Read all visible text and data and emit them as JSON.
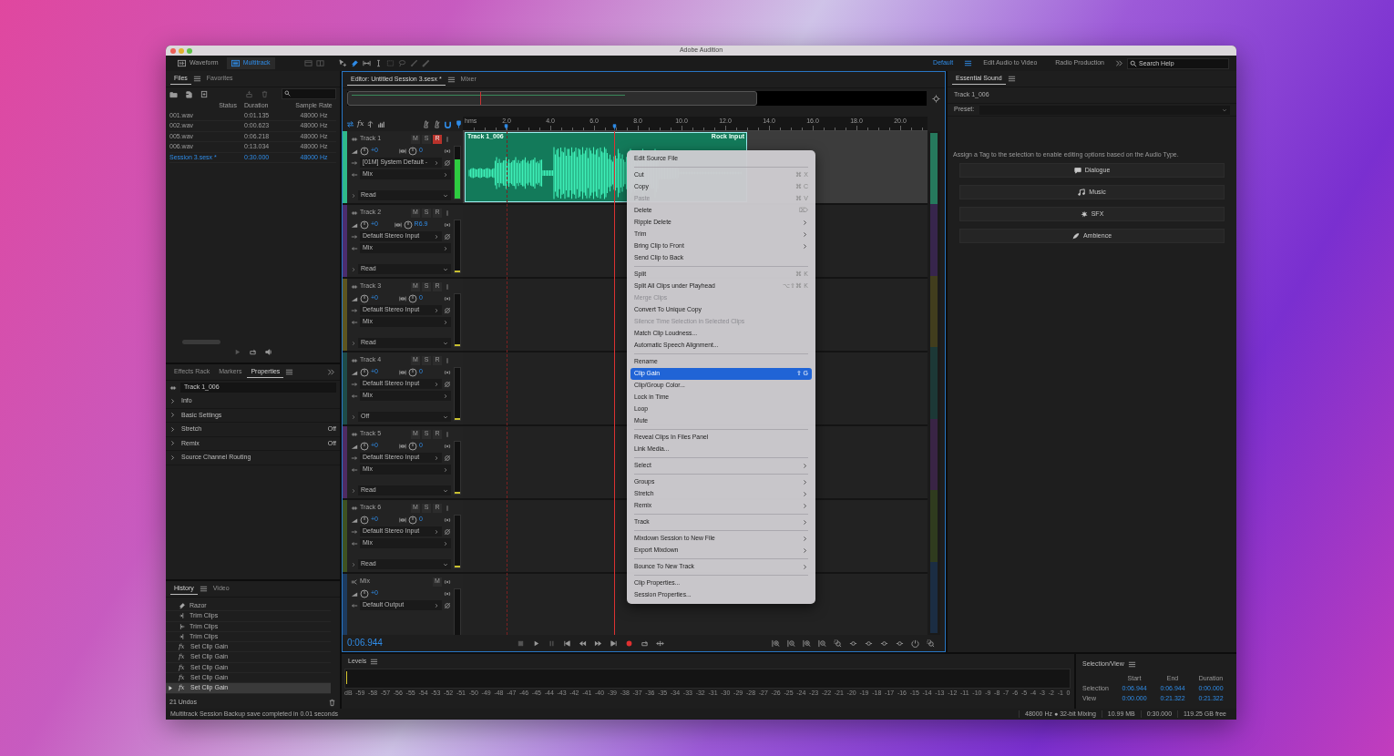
{
  "window": {
    "title": "Adobe Audition"
  },
  "toolbar": {
    "modes": [
      {
        "label": "Waveform",
        "selected": false
      },
      {
        "label": "Multitrack",
        "selected": true
      }
    ],
    "workspaces": [
      {
        "label": "Default",
        "selected": true
      },
      {
        "label": "Edit Audio to Video",
        "selected": false
      },
      {
        "label": "Radio Production",
        "selected": false
      }
    ],
    "search": {
      "placeholder": "Search Help"
    }
  },
  "files_panel": {
    "tabs": [
      {
        "label": "Files",
        "selected": true
      },
      {
        "label": "Favorites",
        "selected": false
      }
    ],
    "columns": [
      "Status",
      "Duration",
      "Sample Rate"
    ],
    "rows": [
      {
        "name": "001.wav",
        "duration": "0:01.135",
        "rate": "48000 Hz",
        "selected": false
      },
      {
        "name": "002.wav",
        "duration": "0:00.623",
        "rate": "48000 Hz",
        "selected": false
      },
      {
        "name": "005.wav",
        "duration": "0:06.218",
        "rate": "48000 Hz",
        "selected": false
      },
      {
        "name": "006.wav",
        "duration": "0:13.034",
        "rate": "48000 Hz",
        "selected": false
      },
      {
        "name": "Session 3.sesx *",
        "duration": "0:30.000",
        "rate": "48000 Hz",
        "selected": true
      }
    ]
  },
  "properties_panel": {
    "tabs": [
      {
        "label": "Effects Rack",
        "selected": false
      },
      {
        "label": "Markers",
        "selected": false
      },
      {
        "label": "Properties",
        "selected": true
      }
    ],
    "name_field": "Track 1_006",
    "sections": [
      {
        "label": "Info"
      },
      {
        "label": "Basic Settings"
      },
      {
        "label": "Stretch",
        "value": "Off"
      },
      {
        "label": "Remix",
        "value": "Off"
      },
      {
        "label": "Source Channel Routing"
      }
    ]
  },
  "history_panel": {
    "tabs": [
      {
        "label": "History",
        "selected": true
      },
      {
        "label": "Video",
        "selected": false
      }
    ],
    "items": [
      {
        "kind": "razor",
        "label": "Razor",
        "selected": false
      },
      {
        "kind": "trim_right",
        "label": "Trim Clips",
        "selected": false
      },
      {
        "kind": "trim_left",
        "label": "Trim Clips",
        "selected": false
      },
      {
        "kind": "trim_right",
        "label": "Trim Clips",
        "selected": false
      },
      {
        "kind": "fx",
        "glyph": "fx",
        "label": "Set Clip Gain",
        "selected": false
      },
      {
        "kind": "fx",
        "glyph": "fx",
        "label": "Set Clip Gain",
        "selected": false
      },
      {
        "kind": "fx",
        "glyph": "fx",
        "label": "Set Clip Gain",
        "selected": false
      },
      {
        "kind": "fx",
        "glyph": "fx",
        "label": "Set Clip Gain",
        "selected": false
      },
      {
        "kind": "fx",
        "glyph": "fx",
        "label": "Set Clip Gain",
        "selected": true
      }
    ],
    "undos": "21 Undos"
  },
  "editor": {
    "tabs": [
      {
        "label": "Editor: Untitled Session 3.sesx *",
        "selected": true
      },
      {
        "label": "Mixer",
        "selected": false
      }
    ],
    "fx_button": "fx",
    "ruler": {
      "unit": "hms",
      "labels": [
        "2.0",
        "4.0",
        "6.0",
        "8.0",
        "10.0",
        "12.0",
        "14.0",
        "16.0",
        "18.0",
        "20.0"
      ]
    },
    "tracks": [
      {
        "kind": "track",
        "name": "Track 1",
        "color": "#2fb98b",
        "buttons": [
          "M",
          "S",
          "R"
        ],
        "armed": true,
        "volume": "+0",
        "pan": "0",
        "input": "[01M] System Default -",
        "output": "Mix",
        "automation": "Read",
        "level": 0.75,
        "selected": true,
        "clip": {
          "title": "Track 1_006",
          "label": "Rock Input"
        }
      },
      {
        "kind": "track",
        "name": "Track 2",
        "color": "#4b2d6e",
        "buttons": [
          "M",
          "S",
          "R"
        ],
        "armed": false,
        "volume": "+0",
        "pan": "R6.9",
        "input": "Default Stereo Input",
        "output": "Mix",
        "automation": "Read",
        "level": 0.03,
        "selected": false
      },
      {
        "kind": "track",
        "name": "Track 3",
        "color": "#5c5520",
        "buttons": [
          "M",
          "S",
          "R"
        ],
        "armed": false,
        "volume": "+0",
        "pan": "0",
        "input": "Default Stereo Input",
        "output": "Mix",
        "automation": "Read",
        "level": 0.03,
        "selected": false
      },
      {
        "kind": "track",
        "name": "Track 4",
        "color": "#1e4c49",
        "buttons": [
          "M",
          "S",
          "R"
        ],
        "armed": false,
        "volume": "+0",
        "pan": "0",
        "input": "Default Stereo Input",
        "output": "Mix",
        "automation": "Off",
        "level": 0.03,
        "selected": false
      },
      {
        "kind": "track",
        "name": "Track 5",
        "color": "#4e2b63",
        "buttons": [
          "M",
          "S",
          "R"
        ],
        "armed": false,
        "volume": "+0",
        "pan": "0",
        "input": "Default Stereo Input",
        "output": "Mix",
        "automation": "Read",
        "level": 0.03,
        "selected": false
      },
      {
        "kind": "track",
        "name": "Track 6",
        "color": "#3e5222",
        "buttons": [
          "M",
          "S",
          "R"
        ],
        "armed": false,
        "volume": "+0",
        "pan": "0",
        "input": "Default Stereo Input",
        "output": "Mix",
        "automation": "Read",
        "level": 0.03,
        "selected": false
      },
      {
        "kind": "master",
        "name": "Mix",
        "color": "#1d3b5f",
        "buttons": [
          "M"
        ],
        "volume": "+0",
        "output": "Default Output",
        "selected": false
      }
    ],
    "time": "0:06.944"
  },
  "context_menu": {
    "items": [
      {
        "kind": "item",
        "label": "Edit Source File",
        "selected": false,
        "disabled": false,
        "submenu": false
      },
      {
        "kind": "separator"
      },
      {
        "kind": "item",
        "label": "Cut",
        "shortcut": "⌘ X",
        "selected": false,
        "disabled": false,
        "submenu": false
      },
      {
        "kind": "item",
        "label": "Copy",
        "shortcut": "⌘ C",
        "selected": false,
        "disabled": false,
        "submenu": false
      },
      {
        "kind": "item",
        "label": "Paste",
        "shortcut": "⌘ V",
        "selected": false,
        "disabled": true,
        "submenu": false
      },
      {
        "kind": "item",
        "label": "Delete",
        "shortcut": "⌦",
        "selected": false,
        "disabled": false,
        "submenu": false
      },
      {
        "kind": "item",
        "label": "Ripple Delete",
        "selected": false,
        "disabled": false,
        "submenu": true
      },
      {
        "kind": "item",
        "label": "Trim",
        "selected": false,
        "disabled": false,
        "submenu": true
      },
      {
        "kind": "item",
        "label": "Bring Clip to Front",
        "selected": false,
        "disabled": false,
        "submenu": true
      },
      {
        "kind": "item",
        "label": "Send Clip to Back",
        "selected": false,
        "disabled": false,
        "submenu": false
      },
      {
        "kind": "separator"
      },
      {
        "kind": "item",
        "label": "Split",
        "shortcut": "⌘ K",
        "selected": false,
        "disabled": false,
        "submenu": false
      },
      {
        "kind": "item",
        "label": "Split All Clips under Playhead",
        "shortcut": "⌥⇧⌘ K",
        "selected": false,
        "disabled": false,
        "submenu": false
      },
      {
        "kind": "item",
        "label": "Merge Clips",
        "selected": false,
        "disabled": true,
        "submenu": false
      },
      {
        "kind": "item",
        "label": "Convert To Unique Copy",
        "selected": false,
        "disabled": false,
        "submenu": false
      },
      {
        "kind": "item",
        "label": "Silence Time Selection in Selected Clips",
        "selected": false,
        "disabled": true,
        "submenu": false
      },
      {
        "kind": "item",
        "label": "Match Clip Loudness...",
        "selected": false,
        "disabled": false,
        "submenu": false
      },
      {
        "kind": "item",
        "label": "Automatic Speech Alignment...",
        "selected": false,
        "disabled": false,
        "submenu": false
      },
      {
        "kind": "separator"
      },
      {
        "kind": "item",
        "label": "Rename",
        "selected": false,
        "disabled": false,
        "submenu": false
      },
      {
        "kind": "item",
        "label": "Clip Gain",
        "shortcut": "⇧ G",
        "selected": true,
        "disabled": false,
        "submenu": false
      },
      {
        "kind": "item",
        "label": "Clip/Group Color...",
        "selected": false,
        "disabled": false,
        "submenu": false
      },
      {
        "kind": "item",
        "label": "Lock in Time",
        "selected": false,
        "disabled": false,
        "submenu": false
      },
      {
        "kind": "item",
        "label": "Loop",
        "selected": false,
        "disabled": false,
        "submenu": false
      },
      {
        "kind": "item",
        "label": "Mute",
        "selected": false,
        "disabled": false,
        "submenu": false
      },
      {
        "kind": "separator"
      },
      {
        "kind": "item",
        "label": "Reveal Clips In Files Panel",
        "selected": false,
        "disabled": false,
        "submenu": false
      },
      {
        "kind": "item",
        "label": "Link Media...",
        "selected": false,
        "disabled": false,
        "submenu": false
      },
      {
        "kind": "separator"
      },
      {
        "kind": "item",
        "label": "Select",
        "selected": false,
        "disabled": false,
        "submenu": true
      },
      {
        "kind": "separator"
      },
      {
        "kind": "item",
        "label": "Groups",
        "selected": false,
        "disabled": false,
        "submenu": true
      },
      {
        "kind": "item",
        "label": "Stretch",
        "selected": false,
        "disabled": false,
        "submenu": true
      },
      {
        "kind": "item",
        "label": "Remix",
        "selected": false,
        "disabled": false,
        "submenu": true
      },
      {
        "kind": "separator"
      },
      {
        "kind": "item",
        "label": "Track",
        "selected": false,
        "disabled": false,
        "submenu": true
      },
      {
        "kind": "separator"
      },
      {
        "kind": "item",
        "label": "Mixdown Session to New File",
        "selected": false,
        "disabled": false,
        "submenu": true
      },
      {
        "kind": "item",
        "label": "Export Mixdown",
        "selected": false,
        "disabled": false,
        "submenu": true
      },
      {
        "kind": "separator"
      },
      {
        "kind": "item",
        "label": "Bounce To New Track",
        "selected": false,
        "disabled": false,
        "submenu": true
      },
      {
        "kind": "separator"
      },
      {
        "kind": "item",
        "label": "Clip Properties...",
        "selected": false,
        "disabled": false,
        "submenu": false
      },
      {
        "kind": "item",
        "label": "Session Properties...",
        "selected": false,
        "disabled": false,
        "submenu": false
      }
    ]
  },
  "essential_sound": {
    "title": "Essential Sound",
    "track": "Track 1_006",
    "preset_label": "Preset:",
    "hint": "Assign a Tag to the selection to enable editing options based on the Audio Type.",
    "types": [
      {
        "kind": "dialogue",
        "label": "Dialogue"
      },
      {
        "kind": "music",
        "label": "Music"
      },
      {
        "kind": "sfx",
        "label": "SFX"
      },
      {
        "kind": "ambience",
        "label": "Ambience"
      }
    ]
  },
  "levels": {
    "title": "Levels",
    "scale": [
      "dB",
      "-59",
      "-58",
      "-57",
      "-56",
      "-55",
      "-54",
      "-53",
      "-52",
      "-51",
      "-50",
      "-49",
      "-48",
      "-47",
      "-46",
      "-45",
      "-44",
      "-43",
      "-42",
      "-41",
      "-40",
      "-39",
      "-38",
      "-37",
      "-36",
      "-35",
      "-34",
      "-33",
      "-32",
      "-31",
      "-30",
      "-29",
      "-28",
      "-27",
      "-26",
      "-25",
      "-24",
      "-23",
      "-22",
      "-21",
      "-20",
      "-19",
      "-18",
      "-17",
      "-16",
      "-15",
      "-14",
      "-13",
      "-12",
      "-11",
      "-10",
      "-9",
      "-8",
      "-7",
      "-6",
      "-5",
      "-4",
      "-3",
      "-2",
      "-1",
      "0"
    ]
  },
  "selection_view": {
    "title": "Selection/View",
    "columns": [
      "Start",
      "End",
      "Duration"
    ],
    "rows": [
      {
        "label": "Selection",
        "values": [
          "0:06.944",
          "0:06.944",
          "0:00.000"
        ]
      },
      {
        "label": "View",
        "values": [
          "0:00.000",
          "0:21.322",
          "0:21.322"
        ]
      }
    ]
  },
  "status_bar": {
    "message": "Multitrack Session Backup save completed in 0.01 seconds",
    "items": [
      "48000 Hz ● 32-bit Mixing",
      "10.99 MB",
      "0:30.000",
      "119.25 GB free"
    ]
  }
}
